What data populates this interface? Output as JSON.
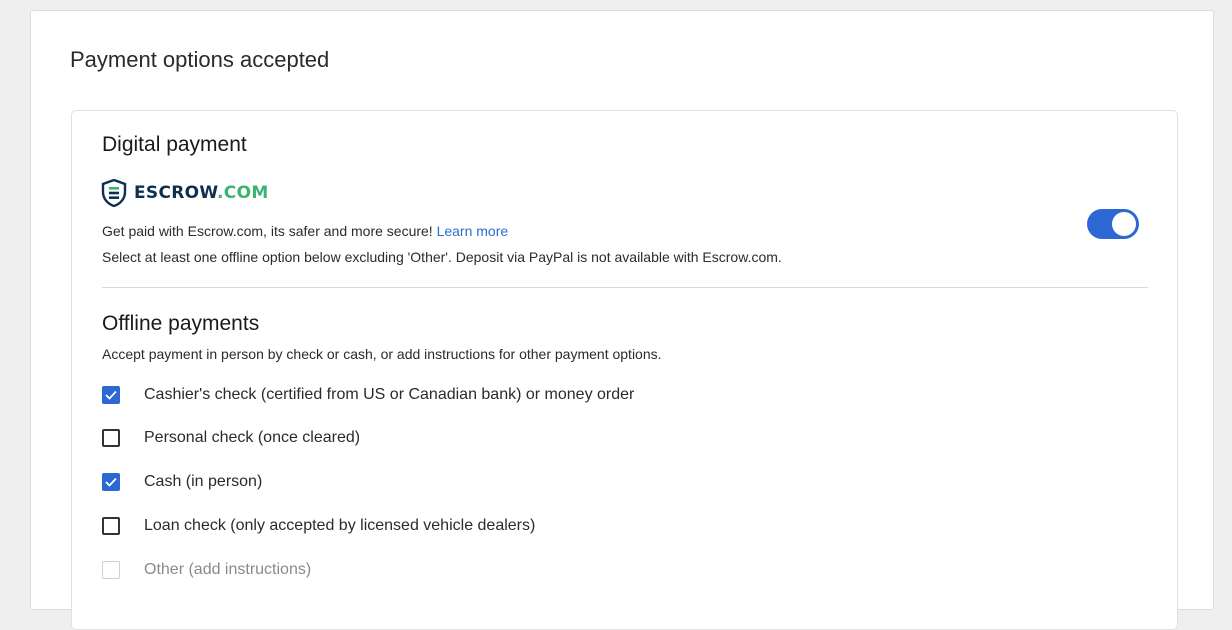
{
  "page": {
    "title": "Payment options accepted"
  },
  "digital": {
    "heading": "Digital payment",
    "logo": {
      "name": "ESCROW",
      "suffix": ".COM",
      "icon": "escrow-shield-icon"
    },
    "description": "Get paid with Escrow.com, its safer and more secure! ",
    "learn_more": "Learn more",
    "note": "Select at least one offline option below excluding 'Other'. Deposit via PayPal is not available with Escrow.com.",
    "toggle_on": true
  },
  "offline": {
    "heading": "Offline payments",
    "description": "Accept payment in person by check or cash, or add instructions for other payment options.",
    "options": [
      {
        "label": "Cashier's check (certified from US or Canadian bank) or money order",
        "checked": true,
        "disabled": false
      },
      {
        "label": "Personal check (once cleared)",
        "checked": false,
        "disabled": false
      },
      {
        "label": "Cash (in person)",
        "checked": true,
        "disabled": false
      },
      {
        "label": "Loan check (only accepted by licensed vehicle dealers)",
        "checked": false,
        "disabled": false
      },
      {
        "label": "Other (add instructions)",
        "checked": false,
        "disabled": true
      }
    ]
  },
  "colors": {
    "accent": "#2d67d4",
    "link": "#2a6fd1",
    "brand_navy": "#0f2f4f",
    "brand_green": "#3cb371"
  }
}
